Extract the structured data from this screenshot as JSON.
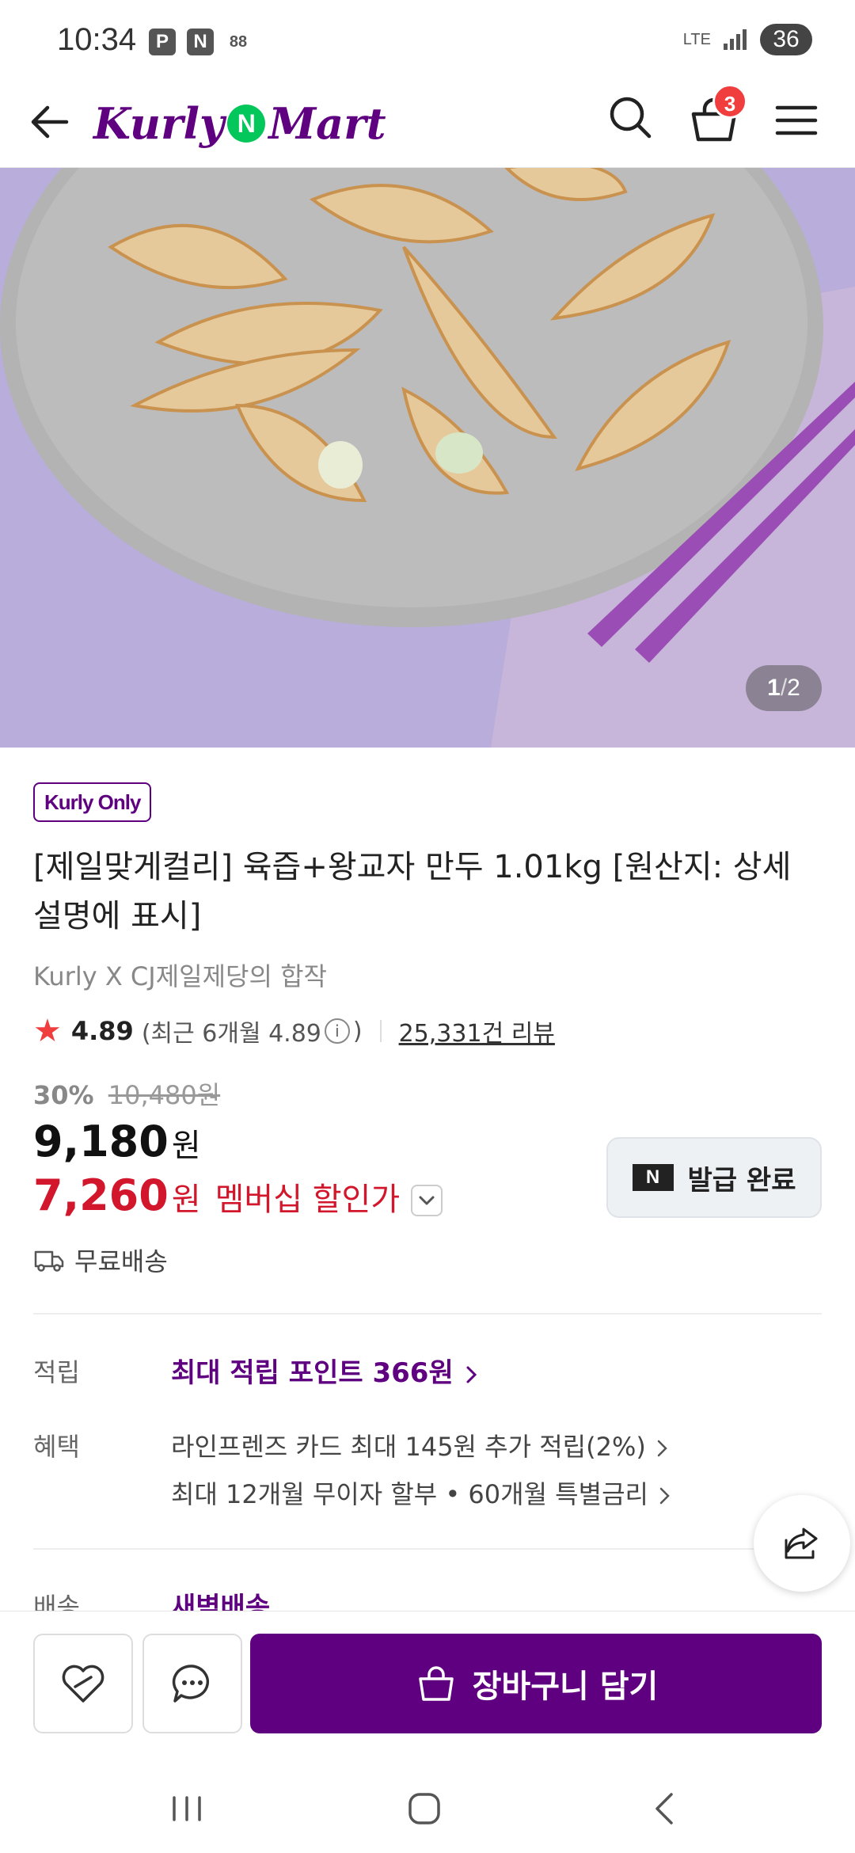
{
  "status_bar": {
    "time": "10:34",
    "icons": [
      "P",
      "N",
      "88"
    ],
    "network": "LTE",
    "battery": "36"
  },
  "header": {
    "logo_left": "Kurly",
    "logo_mid": "N",
    "logo_right": "Mart",
    "cart_count": "3",
    "icons": [
      "back-arrow-icon",
      "search-icon",
      "cart-icon",
      "menu-icon"
    ]
  },
  "gallery": {
    "current": "1",
    "separator": "/",
    "total": "2"
  },
  "product": {
    "badge": "Kurly Only",
    "title": "[제일맞게컬리] 육즙+왕교자 만두 1.01kg [원산지: 상세설명에 표시]",
    "subtitle": "Kurly X CJ제일제당의 합작",
    "rating": "4.89",
    "rating_recent_prefix": "(최근 6개월 4.89",
    "rating_info": "i",
    "rating_recent_suffix": ")",
    "reviews": "25,331건 리뷰",
    "discount_pct": "30%",
    "original_price": "10,480원",
    "price": "9,180",
    "price_unit": "원",
    "member_price": "7,260",
    "member_unit": "원",
    "member_label": "멤버십 할인가",
    "coupon_label": "발급 완료",
    "coupon_logo": "N",
    "shipping": "무료배송"
  },
  "details": {
    "point_label": "적립",
    "point_value": "최대 적립 포인트 366원",
    "benefit_label": "혜택",
    "benefit_1": "라인프렌즈 카드 최대 145원 추가 적립(2%)",
    "benefit_2": "최대 12개월 무이자 할부 • 60개월 특별금리",
    "delivery_label": "배송",
    "delivery_value": "새벽배송"
  },
  "action_bar": {
    "cart_button": "장바구니 담기"
  },
  "colors": {
    "brand": "#5f0080",
    "sale": "#d2172c",
    "star": "#f03e3e"
  }
}
